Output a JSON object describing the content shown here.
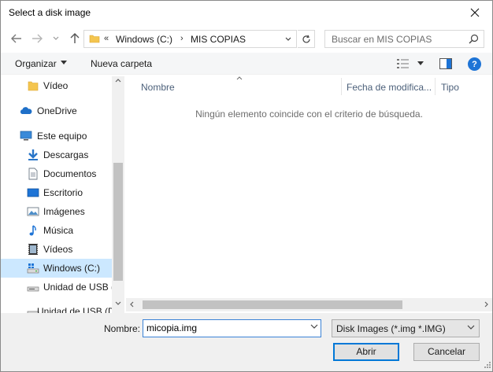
{
  "window": {
    "title": "Select a disk image"
  },
  "address": {
    "chevrons": "«",
    "segments": [
      "Windows (C:)",
      "MIS COPIAS"
    ],
    "separator": "›"
  },
  "search": {
    "placeholder": "Buscar en MIS COPIAS"
  },
  "toolbar": {
    "organize_label": "Organizar",
    "new_folder_label": "Nueva carpeta",
    "help_label": "?"
  },
  "nav": {
    "items": [
      {
        "label": "Vídeo",
        "icon": "folder-icon"
      },
      {
        "label": "OneDrive",
        "icon": "cloud-icon"
      },
      {
        "label": "Este equipo",
        "icon": "computer-icon"
      },
      {
        "label": "Descargas",
        "icon": "download-icon"
      },
      {
        "label": "Documentos",
        "icon": "document-icon"
      },
      {
        "label": "Escritorio",
        "icon": "desktop-icon"
      },
      {
        "label": "Imágenes",
        "icon": "image-icon"
      },
      {
        "label": "Música",
        "icon": "music-icon"
      },
      {
        "label": "Vídeos",
        "icon": "video-icon"
      },
      {
        "label": "Windows (C:)",
        "icon": "drive-icon",
        "selected": true
      },
      {
        "label": "Unidad de USB (",
        "icon": "usb-drive-icon"
      },
      {
        "label": "Unidad de USB (D",
        "icon": "usb-drive-icon"
      }
    ]
  },
  "filelist": {
    "columns": [
      "Nombre",
      "Fecha de modifica...",
      "Tipo"
    ],
    "empty_message": "Ningún elemento coincide con el criterio de búsqueda."
  },
  "bottom": {
    "name_label": "Nombre:",
    "name_value": "micopia.img",
    "filter_value": "Disk Images (*.img *.IMG)",
    "open_label": "Abrir",
    "cancel_label": "Cancelar"
  },
  "colors": {
    "accent": "#0078d7",
    "selected_bg": "#cce8ff",
    "help_blue": "#1e74d6"
  }
}
